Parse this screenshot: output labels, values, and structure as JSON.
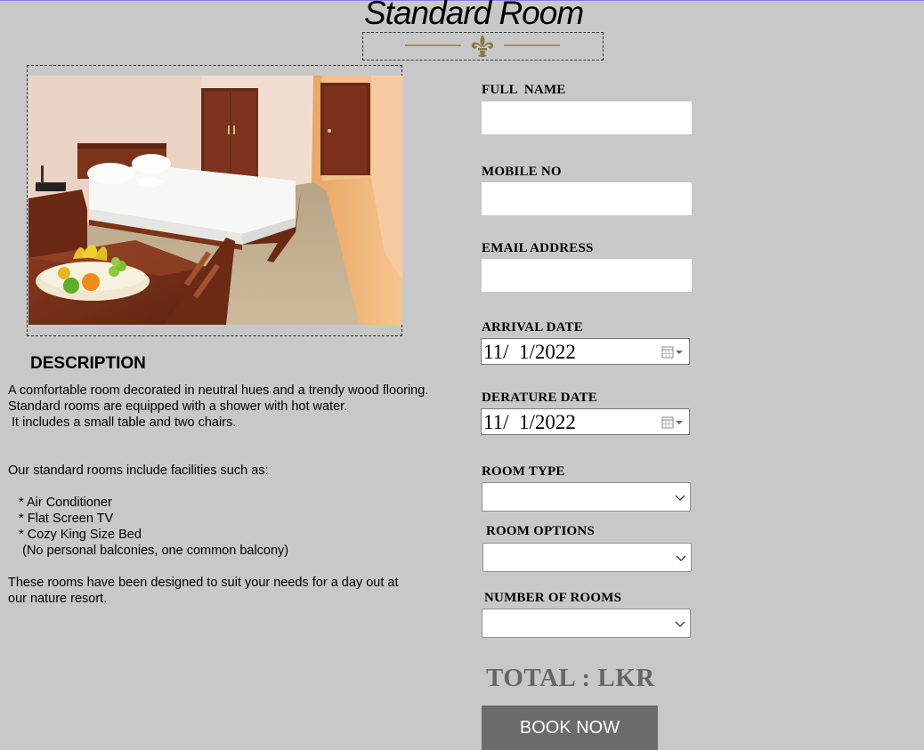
{
  "page": {
    "title": "Standard Room"
  },
  "description": {
    "heading": "DESCRIPTION",
    "paragraph1": "A comfortable room decorated in neutral hues and a trendy wood flooring.\nStandard rooms are equipped with a shower with hot water.\n It includes a small table and two chairs.",
    "paragraph2": "Our standard rooms include facilities such as:",
    "facilities": "   * Air Conditioner\n   * Flat Screen TV\n   * Cozy King Size Bed\n    (No personal balconies, one common balcony)",
    "paragraph3": "These rooms have been designed to suit your needs for a day out at\nour nature resort."
  },
  "form": {
    "full_name": {
      "label": "FULL  NAME",
      "value": ""
    },
    "mobile_no": {
      "label": "MOBILE NO",
      "value": ""
    },
    "email": {
      "label": "EMAIL ADDRESS",
      "value": ""
    },
    "arrival_date": {
      "label": "ARRIVAL DATE",
      "value": "11/  1/2022"
    },
    "departure_date": {
      "label": "DERATURE DATE",
      "value": "11/  1/2022"
    },
    "room_type": {
      "label": "ROOM TYPE",
      "value": ""
    },
    "room_options": {
      "label": "ROOM OPTIONS",
      "value": ""
    },
    "number_of_rooms": {
      "label": "NUMBER OF ROOMS",
      "value": ""
    },
    "total_label": "TOTAL : LKR",
    "book_button": "BOOK NOW"
  },
  "icons": {
    "ornament": "fleur-de-lis-divider-icon",
    "calendar": "calendar-dropdown-icon",
    "select": "chevron-down-icon"
  },
  "colors": {
    "background": "#c8c8c8",
    "ornament_gold": "#8b7a4a",
    "button": "#6b6b6b",
    "total_text": "#666666",
    "top_border": "#8a7fd6"
  }
}
